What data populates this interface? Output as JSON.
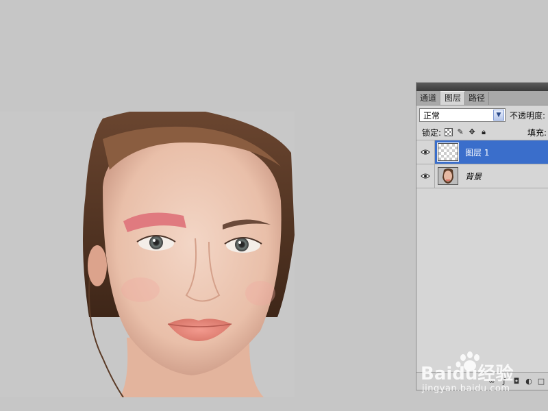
{
  "layers_panel": {
    "tabs": [
      {
        "label": "通道",
        "active": false
      },
      {
        "label": "图层",
        "active": true
      },
      {
        "label": "路径",
        "active": false
      }
    ],
    "blend_mode": "正常",
    "opacity_label": "不透明度:",
    "lock_label": "锁定:",
    "fill_label": "填充:",
    "layers": [
      {
        "name": "图层 1",
        "selected": true,
        "visible": true
      },
      {
        "name": "背景",
        "selected": false,
        "visible": true
      }
    ]
  },
  "watermark": {
    "logo": "Baidu经验",
    "url": "jingyan.baidu.com"
  },
  "colors": {
    "selection": "#3a6ecb",
    "brush_stroke": "#e07a7f",
    "panel_bg": "#d6d6d6"
  }
}
